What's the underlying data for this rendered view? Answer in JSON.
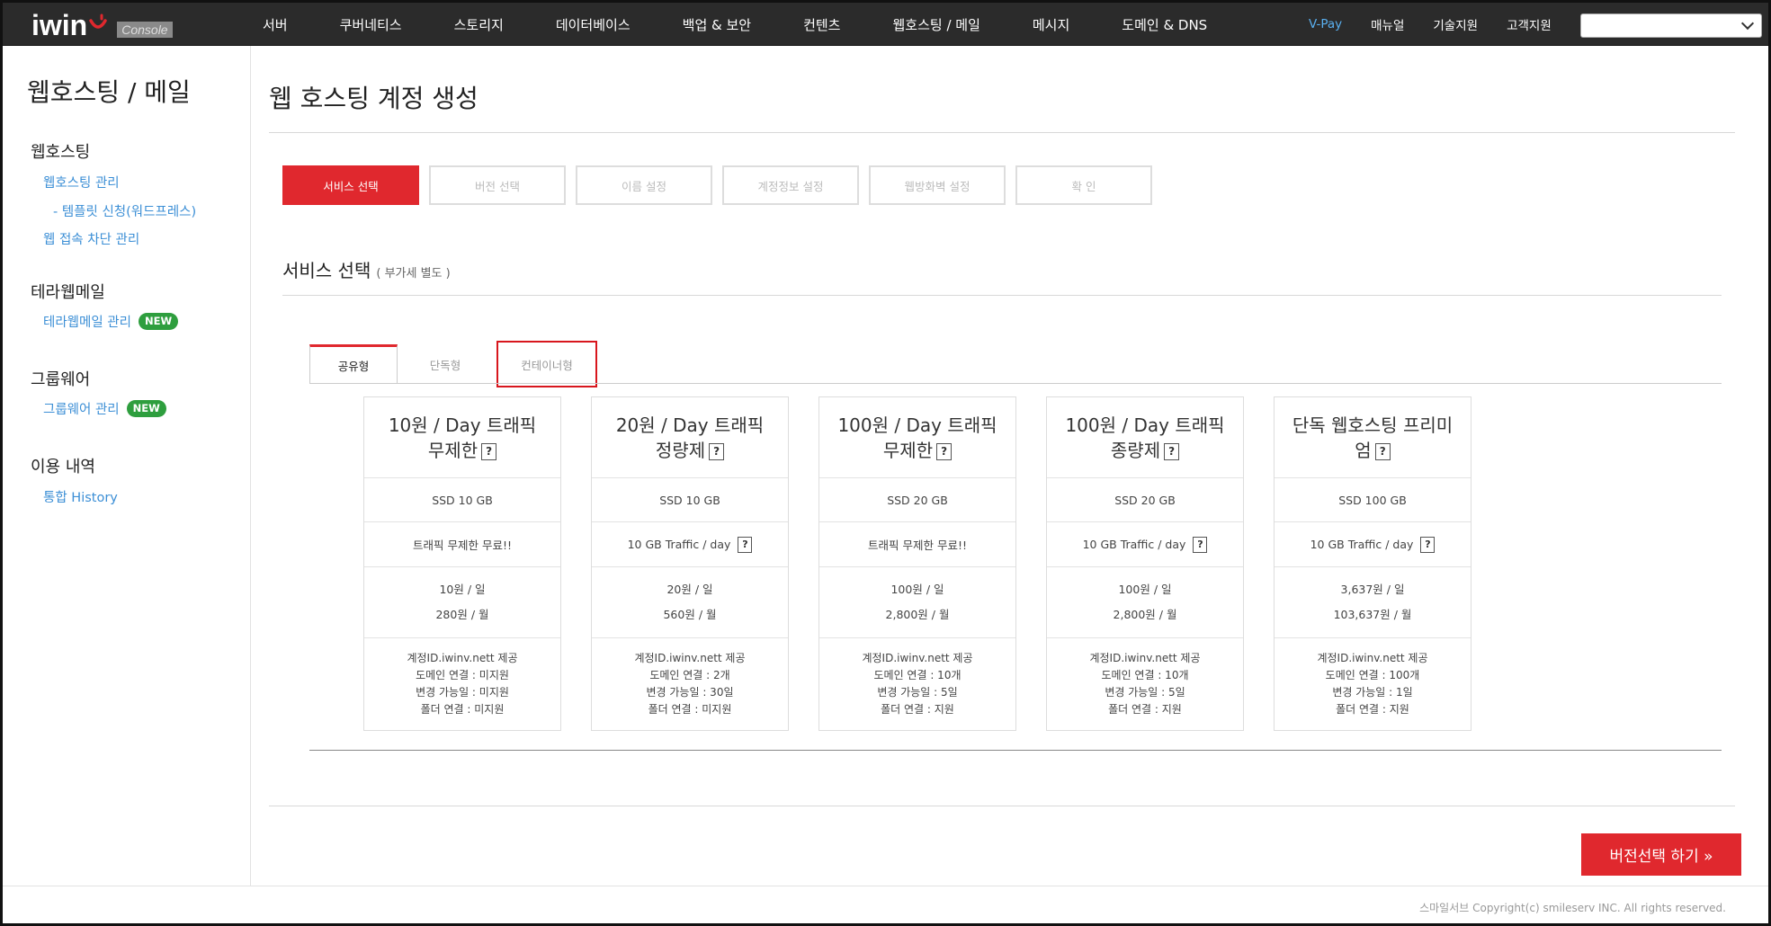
{
  "logo": {
    "text": "iwin",
    "badge": "Console"
  },
  "nav": {
    "items": [
      "서버",
      "쿠버네티스",
      "스토리지",
      "데이터베이스",
      "백업 & 보안",
      "컨텐츠",
      "웹호스팅 / 메일",
      "메시지",
      "도메인 & DNS"
    ],
    "right": [
      "V-Pay",
      "매뉴얼",
      "기술지원",
      "고객지원"
    ],
    "select_value": ""
  },
  "sidebar": {
    "title": "웹호스팅 / 메일",
    "groups": [
      {
        "label": "웹호스팅",
        "links": [
          "웹호스팅 관리",
          "- 템플릿 신청(워드프레스)",
          "웹 접속 차단 관리"
        ]
      },
      {
        "label": "테라웹메일",
        "links": [
          "테라웹메일 관리"
        ],
        "badge": "NEW"
      },
      {
        "label": "그룹웨어",
        "links": [
          "그룹웨어 관리"
        ],
        "badge": "NEW"
      },
      {
        "label": "이용 내역",
        "links": [
          "통합 History"
        ]
      }
    ]
  },
  "page": {
    "title": "웹 호스팅 계정 생성",
    "steps": [
      "서비스 선택",
      "버전 선택",
      "이름 설정",
      "계정정보 설정",
      "웹방화벽 설정",
      "확 인"
    ],
    "section_title": "서비스 선택",
    "section_note": "( 부가세 별도 )",
    "tabs": [
      "공유형",
      "단독형",
      "컨테이너형"
    ],
    "next_button": "버전선택 하기 »",
    "copyright": "스마일서브 Copyright(c) smileserv INC. All rights reserved."
  },
  "cards": [
    {
      "name": "10원 / Day 트래픽 무제한",
      "storage": "SSD 10 GB",
      "traffic": "트래픽 무제한 무료!!",
      "traffic_help": false,
      "price_day": "10원 / 일",
      "price_month": "280원 / 월",
      "info": [
        "계정ID.iwinv.nett 제공",
        "도메인 연결 : 미지원",
        "변경 가능일 : 미지원",
        "폴더 연결 : 미지원"
      ]
    },
    {
      "name": "20원 / Day 트래픽 정량제",
      "storage": "SSD 10 GB",
      "traffic": "10 GB Traffic / day",
      "traffic_help": true,
      "price_day": "20원 / 일",
      "price_month": "560원 / 월",
      "info": [
        "계정ID.iwinv.nett 제공",
        "도메인 연결 : 2개",
        "변경 가능일 : 30일",
        "폴더 연결 : 미지원"
      ]
    },
    {
      "name": "100원 / Day 트래픽 무제한",
      "storage": "SSD 20 GB",
      "traffic": "트래픽 무제한 무료!!",
      "traffic_help": false,
      "price_day": "100원 / 일",
      "price_month": "2,800원 / 월",
      "info": [
        "계정ID.iwinv.nett 제공",
        "도메인 연결 : 10개",
        "변경 가능일 : 5일",
        "폴더 연결 : 지원"
      ]
    },
    {
      "name": "100원 / Day 트래픽 종량제",
      "storage": "SSD 20 GB",
      "traffic": "10 GB Traffic / day",
      "traffic_help": true,
      "price_day": "100원 / 일",
      "price_month": "2,800원 / 월",
      "info": [
        "계정ID.iwinv.nett 제공",
        "도메인 연결 : 10개",
        "변경 가능일 : 5일",
        "폴더 연결 : 지원"
      ]
    },
    {
      "name": "단독 웹호스팅 프리미엄",
      "storage": "SSD 100 GB",
      "traffic": "10 GB Traffic / day",
      "traffic_help": true,
      "price_day": "3,637원 / 일",
      "price_month": "103,637원 / 월",
      "info": [
        "계정ID.iwinv.nett 제공",
        "도메인 연결 : 100개",
        "변경 가능일 : 1일",
        "폴더 연결 : 지원"
      ]
    }
  ],
  "colors": {
    "accent": "#e0282e",
    "link": "#3c8fd6",
    "new_badge": "#2e9e3e",
    "topbar": "#2b2b2b"
  }
}
